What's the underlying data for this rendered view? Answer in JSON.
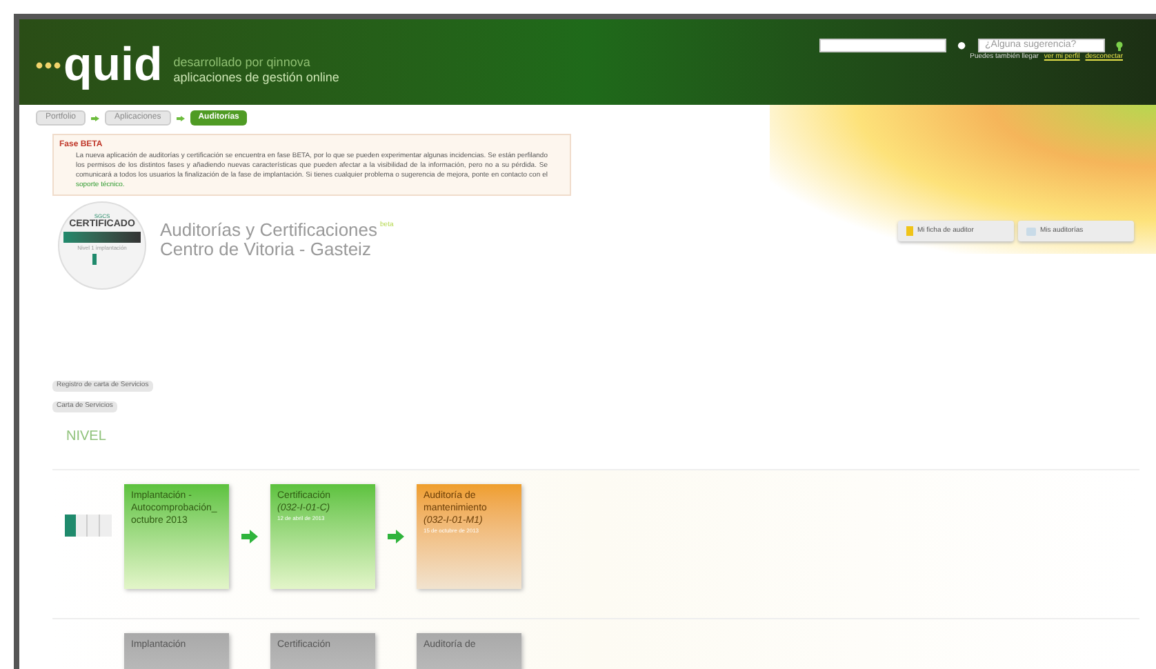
{
  "header": {
    "logo": "quid",
    "tagline": "desarrollado por qinnova",
    "subtitle": "aplicaciones de gestión online",
    "suggestion": {
      "placeholder": "¿Alguna sugerencia?"
    },
    "user_line": {
      "text": "Puedes también llegar",
      "links": [
        "ver mi perfil",
        "desconectar"
      ]
    }
  },
  "breadcrumbs": [
    {
      "label": "Portfolio",
      "selected": false
    },
    {
      "label": "Aplicaciones",
      "selected": false
    },
    {
      "label": "Auditorías",
      "selected": true
    }
  ],
  "notice": {
    "title": "Fase BETA",
    "text": "La nueva aplicación de auditorías y certificación se encuentra en fase BETA, por lo que se pueden experimentar algunas incidencias. Se están perfilando los permisos de los distintos fases y añadiendo nuevas características que pueden afectar a la visibilidad de la información, pero no a su pérdida. Se comunicará a todos los usuarios la finalización de la fase de implantación. Si tienes cualquier problema o sugerencia de mejora, ponte en contacto con el",
    "link": "soporte técnico."
  },
  "badge": {
    "top": "SGCS",
    "title": "CERTIFICADO",
    "caption": "Nivel 1 implantación"
  },
  "title": {
    "line1": "Auditorías y Certificaciones",
    "beta": "beta",
    "line2": "Centro de Vitoria - Gasteiz"
  },
  "actions": [
    {
      "label": "Mi ficha de auditor",
      "kind": "user"
    },
    {
      "label": "Mis auditorías",
      "kind": "doc"
    }
  ],
  "section_buttons": [
    "Registro de carta de Servicios",
    "Carta de Servicios"
  ],
  "level_heading": "NIVEL",
  "rows": [
    {
      "cards": [
        {
          "title": "Implantación - Autocomprobación_octubre 2013",
          "kind": "done"
        },
        {
          "title": "Certificación",
          "code": "(032-I-01-C)",
          "date": "12 de abril de 2013",
          "kind": "done"
        },
        {
          "title": "Auditoría de mantenimiento",
          "code": "(032-I-01-M1)",
          "date": "15 de octubre de 2013",
          "kind": "pending"
        }
      ]
    },
    {
      "cards": [
        {
          "title": "Implantación",
          "kind": "inactive"
        },
        {
          "title": "Certificación",
          "kind": "inactive"
        },
        {
          "title": "Auditoría de",
          "kind": "inactive"
        }
      ]
    }
  ]
}
